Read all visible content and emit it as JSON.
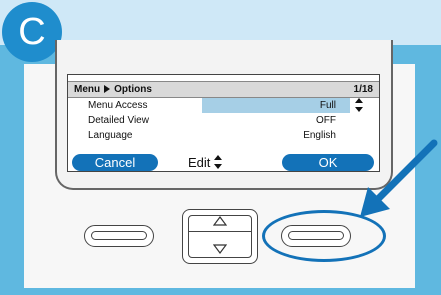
{
  "step_badge": "C",
  "screen": {
    "header": {
      "menu": "Menu",
      "section": "Options",
      "page": "1/18"
    },
    "rows": [
      {
        "label": "Menu Access",
        "value": "Full",
        "selected": true
      },
      {
        "label": "Detailed View",
        "value": "OFF",
        "selected": false
      },
      {
        "label": "Language",
        "value": "English",
        "selected": false
      }
    ],
    "softkeys": {
      "left": "Cancel",
      "middle": "Edit",
      "right": "OK"
    }
  },
  "colors": {
    "background_light": "#cfe8f7",
    "background_band": "#5fb8e0",
    "accent_blue": "#1372b8",
    "selection": "#a6cfe6"
  },
  "icons": {
    "header_separator": "right-triangle",
    "scroll": "up-down-arrows",
    "edit": "up-down-arrows",
    "nav_up": "up-triangle",
    "nav_down": "down-triangle",
    "callout": "arrow"
  }
}
